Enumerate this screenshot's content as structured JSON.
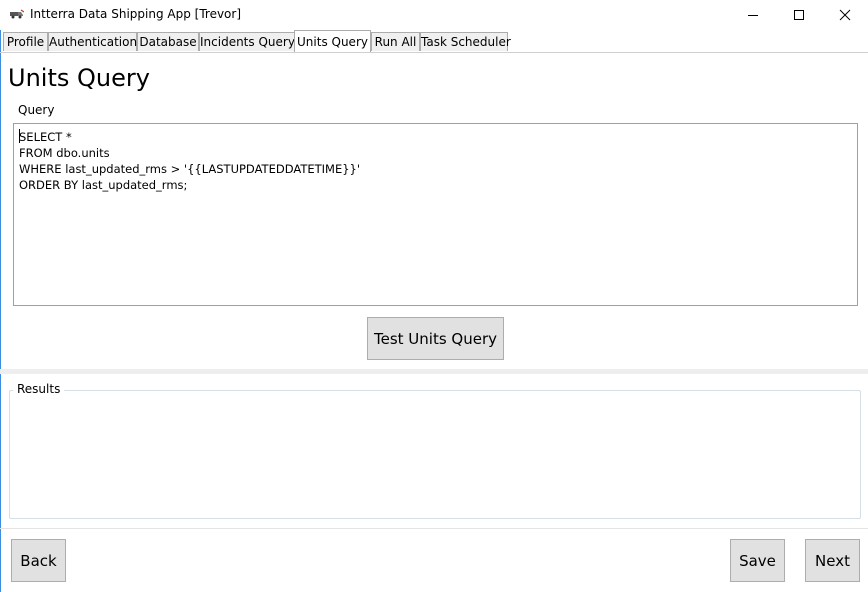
{
  "window": {
    "title": "Intterra Data Shipping App [Trevor]",
    "app_icon": "truck-icon",
    "controls": [
      "minimize-icon",
      "maximize-icon",
      "close-icon"
    ]
  },
  "tabs": [
    {
      "label": "Profile",
      "active": false
    },
    {
      "label": "Authentication",
      "active": false
    },
    {
      "label": "Database",
      "active": false
    },
    {
      "label": "Incidents Query",
      "active": false
    },
    {
      "label": "Units Query",
      "active": true
    },
    {
      "label": "Run All",
      "active": false
    },
    {
      "label": "Task Scheduler",
      "active": false
    }
  ],
  "page": {
    "title": "Units Query",
    "query_label": "Query",
    "query_text": "SELECT *\nFROM dbo.units\nWHERE last_updated_rms > '{{LASTUPDATEDDATETIME}}'\nORDER BY last_updated_rms;",
    "test_button": "Test Units Query",
    "results_label": "Results"
  },
  "footer": {
    "back": "Back",
    "save": "Save",
    "next": "Next"
  },
  "colors": {
    "focus_border": "#7aa9d8",
    "button_bg": "#e1e1e1",
    "tab_bg": "#f0f0f0"
  }
}
